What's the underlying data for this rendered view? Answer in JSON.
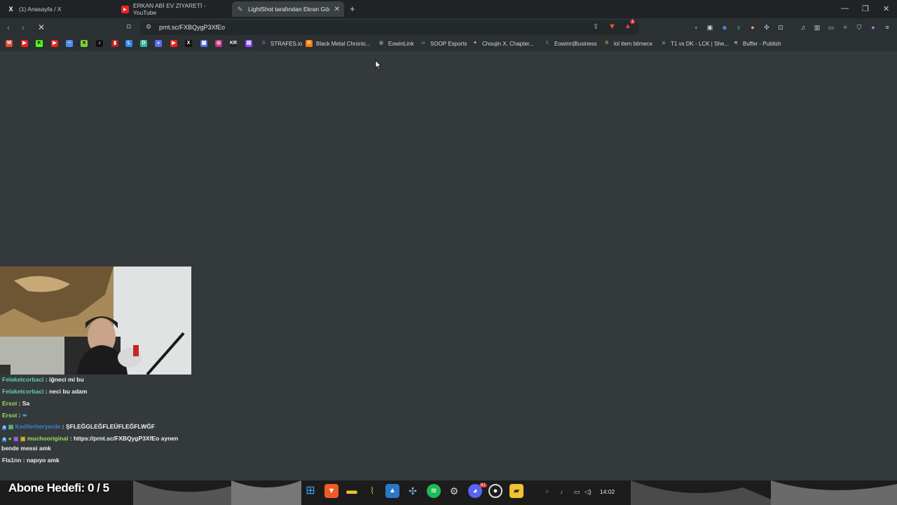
{
  "tabs": [
    {
      "title": "(1) Anasayfa / X",
      "icon": "x-icon"
    },
    {
      "title": "ERKAN ABİ EV ZİYARETİ - YouTube",
      "icon": "youtube-icon"
    },
    {
      "title": "LightShot tarafından Ekran Görü",
      "icon": "lightshot-icon",
      "active": true
    }
  ],
  "address_bar": {
    "url": "prnt.sc/FXBQygP3XfEo"
  },
  "toolbar": {
    "brave_badge": "1"
  },
  "bookmarks": [
    {
      "label": "STRAFES.io",
      "icon": "strafes-icon"
    },
    {
      "label": "Black Metal Chronic...",
      "icon": "blogger-icon"
    },
    {
      "label": "EowinLink",
      "icon": "globe-icon"
    },
    {
      "label": "SOOP Esports",
      "icon": "soop-icon"
    },
    {
      "label": "Choujin X, Chapter...",
      "icon": "manga-icon"
    },
    {
      "label": "Eowinn|Business",
      "icon": "business-icon"
    },
    {
      "label": "lol item bilmece",
      "icon": "bilmece-icon"
    },
    {
      "label": "T1 vs DK - LCK | She...",
      "icon": "t1-icon"
    },
    {
      "label": "Buffer - Publish",
      "icon": "buffer-icon"
    }
  ],
  "chat": {
    "messages": [
      {
        "user": "Felaketcorbaci",
        "text": ": iğneci mi bu",
        "user_color": "#5fd1a8"
      },
      {
        "user": "Felaketcorbaci",
        "text": ": neci bu adam",
        "user_color": "#5fd1a8"
      },
      {
        "user": "Ersoi",
        "text": ": Sa",
        "user_color": "#9be05a"
      },
      {
        "user": "Ersoi",
        "text": ":",
        "user_color": "#9be05a"
      },
      {
        "user": "Kedilerheryerde",
        "text": ": ŞFLEĞGLEĞFLEÜFLEĞFLWĞF",
        "user_color": "#3a7fd6"
      },
      {
        "user": "muchooriginal",
        "text": ": https://prnt.sc/FXBQygP3XfEo aynen",
        "user_color": "#9be05a"
      },
      {
        "user": "",
        "text": "bende messi amk",
        "user_color": "#ffffff"
      },
      {
        "user": "Fla1nn",
        "text": ": napıyo amk",
        "user_color": "#e8e8e8"
      }
    ]
  },
  "stream_overlay": {
    "goal_text": "Abone Hedefi:  0 / 5"
  },
  "taskbar": {
    "time": "14:02",
    "discord_badge": "91"
  }
}
